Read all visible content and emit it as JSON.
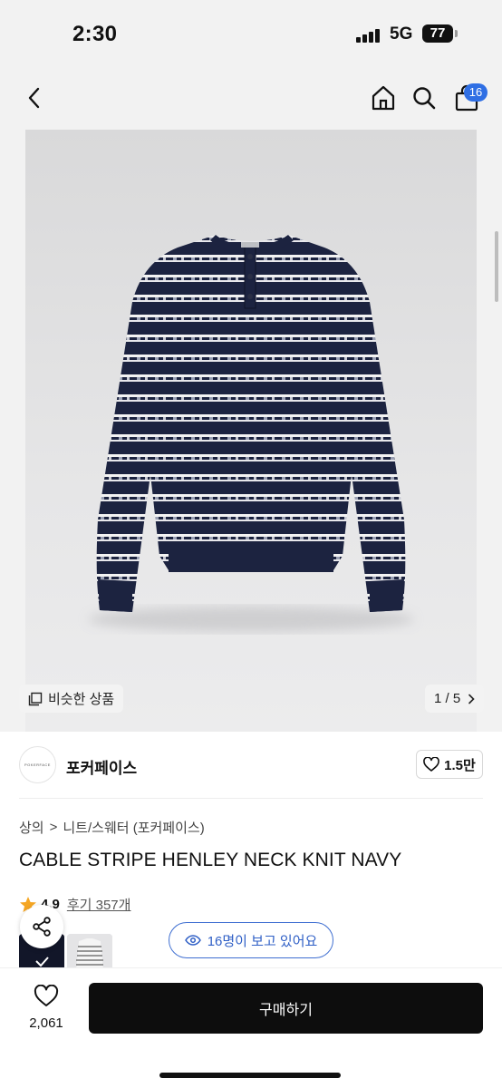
{
  "status_bar": {
    "time": "2:30",
    "network": "5G",
    "battery": "77"
  },
  "nav": {
    "cart_count": "16",
    "icons": [
      "back-arrow-icon",
      "home-icon",
      "search-icon",
      "shopping-bag-icon"
    ]
  },
  "gallery": {
    "similar_label": "비슷한 상품",
    "page_indicator": "1 / 5"
  },
  "brand": {
    "logo_text": "POKERFACE",
    "name": "포커페이스",
    "likes": "1.5만"
  },
  "breadcrumb": {
    "level1": "상의",
    "separator": ">",
    "level2": "니트/스웨터 (포커페이스)"
  },
  "product": {
    "title": "CABLE STRIPE HENLEY NECK KNIT NAVY"
  },
  "rating": {
    "score": "4.9",
    "reviews": "후기 357개"
  },
  "viewers": {
    "text": "16명이 보고 있어요"
  },
  "bottom": {
    "wish_count": "2,061",
    "buy_label": "구매하기"
  },
  "colors": {
    "accent_blue": "#2f6fe4",
    "navy": "#1c2340",
    "buy_button": "#0d0d0d"
  }
}
